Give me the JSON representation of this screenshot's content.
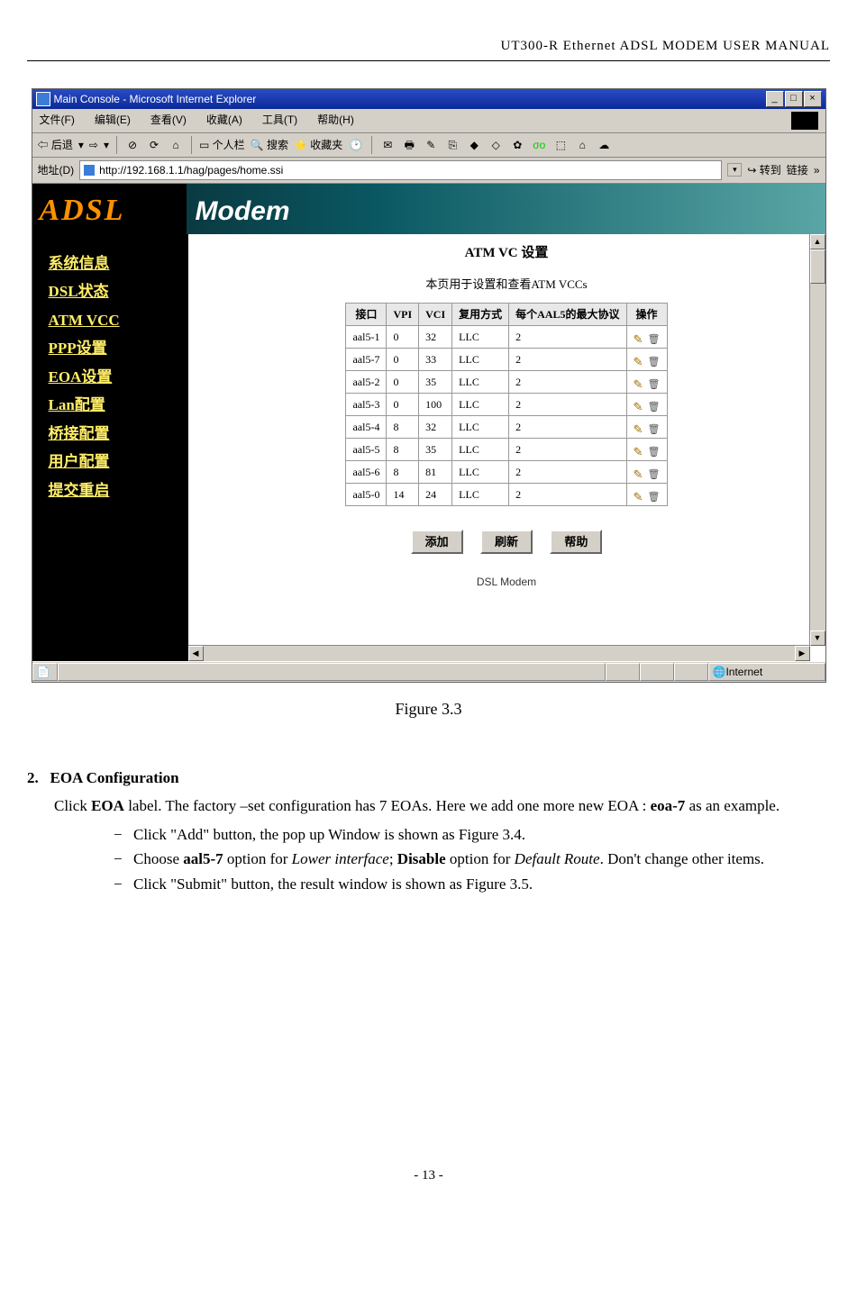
{
  "docHeader": "UT300-R Ethernet ADSL MODEM USER MANUAL",
  "ie": {
    "title": "Main Console - Microsoft Internet Explorer",
    "menus": [
      "文件(F)",
      "编辑(E)",
      "查看(V)",
      "收藏(A)",
      "工具(T)",
      "帮助(H)"
    ],
    "back": "后退",
    "personalBar": "个人栏",
    "search": "搜索",
    "favs": "收藏夹",
    "addrLabel": "地址(D)",
    "url": "http://192.168.1.1/hag/pages/home.ssi",
    "go": "转到",
    "links": "链接",
    "statusZone": "Internet"
  },
  "brand": {
    "adsl": "ADSL",
    "modem": "Modem"
  },
  "nav": [
    "系统信息",
    "DSL状态",
    "ATM VCC",
    "PPP设置",
    "EOA设置",
    "Lan配置",
    "桥接配置",
    "用户配置",
    "提交重启"
  ],
  "page": {
    "title": "ATM VC 设置",
    "subtitle": "本页用于设置和查看ATM VCCs",
    "footer": "DSL Modem"
  },
  "table": {
    "headers": [
      "接口",
      "VPI",
      "VCI",
      "复用方式",
      "每个AAL5的最大协议",
      "操作"
    ],
    "rows": [
      {
        "iface": "aal5-1",
        "vpi": "0",
        "vci": "32",
        "mux": "LLC",
        "max": "2"
      },
      {
        "iface": "aal5-7",
        "vpi": "0",
        "vci": "33",
        "mux": "LLC",
        "max": "2"
      },
      {
        "iface": "aal5-2",
        "vpi": "0",
        "vci": "35",
        "mux": "LLC",
        "max": "2"
      },
      {
        "iface": "aal5-3",
        "vpi": "0",
        "vci": "100",
        "mux": "LLC",
        "max": "2"
      },
      {
        "iface": "aal5-4",
        "vpi": "8",
        "vci": "32",
        "mux": "LLC",
        "max": "2"
      },
      {
        "iface": "aal5-5",
        "vpi": "8",
        "vci": "35",
        "mux": "LLC",
        "max": "2"
      },
      {
        "iface": "aal5-6",
        "vpi": "8",
        "vci": "81",
        "mux": "LLC",
        "max": "2"
      },
      {
        "iface": "aal5-0",
        "vpi": "14",
        "vci": "24",
        "mux": "LLC",
        "max": "2"
      }
    ]
  },
  "buttons": {
    "add": "添加",
    "refresh": "刷新",
    "help": "帮助"
  },
  "caption": "Figure 3.3",
  "section": {
    "num": "2.",
    "title": "EOA Configuration",
    "body_pre": "Click ",
    "body_b1": "EOA",
    "body_mid": " label. The factory –set configuration has 7 EOAs. Here we add one more new EOA : ",
    "body_b2": "eoa-7",
    "body_post": " as an example.",
    "li1": "Click \"Add\" button, the pop up Window is shown as Figure 3.4.",
    "li2_a": "Choose ",
    "li2_b1": "aal5-7",
    "li2_b": " option for ",
    "li2_i1": "Lower interface",
    "li2_c": "; ",
    "li2_b2": "Disable",
    "li2_d": " option for ",
    "li2_i2": "Default Route",
    "li2_e": ". Don't change other items.",
    "li3": "Click \"Submit\" button, the result window is shown as Figure 3.5."
  },
  "pageNum": "- 13 -"
}
